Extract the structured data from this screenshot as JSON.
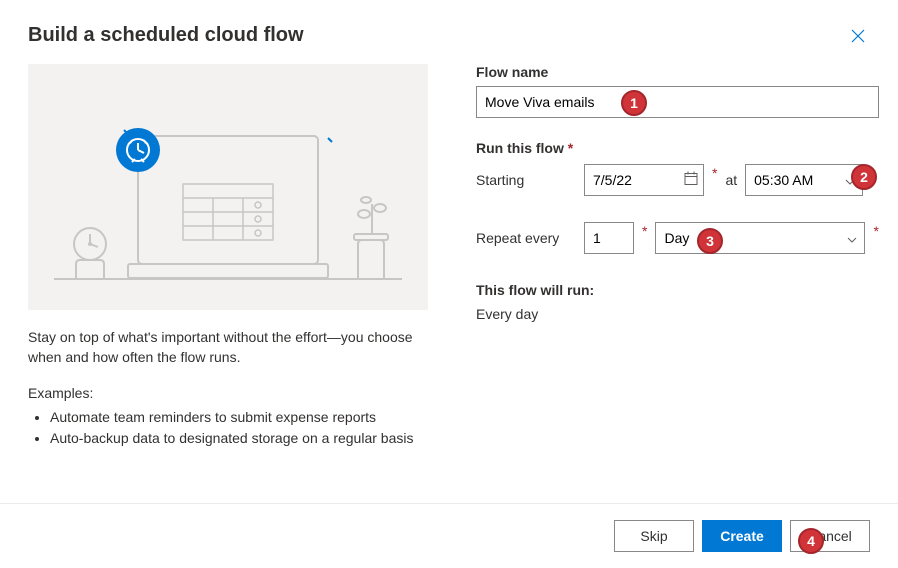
{
  "dialog": {
    "title": "Build a scheduled cloud flow"
  },
  "left": {
    "description": "Stay on top of what's important without the effort—you choose when and how often the flow runs.",
    "examples_title": "Examples:",
    "examples": [
      "Automate team reminders to submit expense reports",
      "Auto-backup data to designated storage on a regular basis"
    ]
  },
  "form": {
    "flow_name_label": "Flow name",
    "flow_name_value": "Move Viva emails",
    "run_label": "Run this flow",
    "starting_label": "Starting",
    "starting_date": "7/5/22",
    "at_label": "at",
    "starting_time": "05:30 AM",
    "repeat_label": "Repeat every",
    "repeat_value": "1",
    "repeat_unit": "Day",
    "summary_title": "This flow will run:",
    "summary_text": "Every day"
  },
  "footer": {
    "skip": "Skip",
    "create": "Create",
    "cancel": "Cancel"
  },
  "callouts": {
    "c1": "1",
    "c2": "2",
    "c3": "3",
    "c4": "4"
  }
}
